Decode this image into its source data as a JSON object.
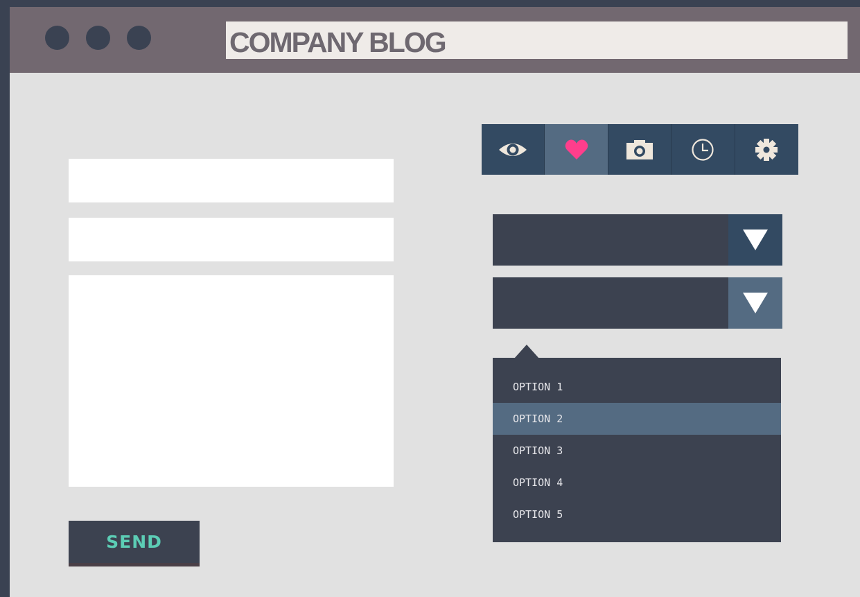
{
  "window": {
    "title": "COMPANY BLOG",
    "controls": [
      "window-dot",
      "window-dot",
      "window-dot"
    ]
  },
  "form": {
    "field1_value": "",
    "field2_value": "",
    "message_value": "",
    "send_label": "SEND"
  },
  "toolbar": {
    "icons": [
      "eye-icon",
      "heart-icon",
      "camera-icon",
      "clock-icon",
      "gear-icon"
    ],
    "active_index": 1
  },
  "dropdowns": [
    {
      "selected": ""
    },
    {
      "selected": ""
    }
  ],
  "menu": {
    "options": [
      "OPTION 1",
      "OPTION 2",
      "OPTION 3",
      "OPTION 4",
      "OPTION 5"
    ],
    "highlighted_index": 1
  },
  "colors": {
    "titlebar": "#726870",
    "nav_dark": "#334a62",
    "nav_active": "#546b82",
    "panel": "#3c4250",
    "heart": "#ff3e8c",
    "send_text": "#5ccdb5",
    "icon": "#efe7dc"
  }
}
